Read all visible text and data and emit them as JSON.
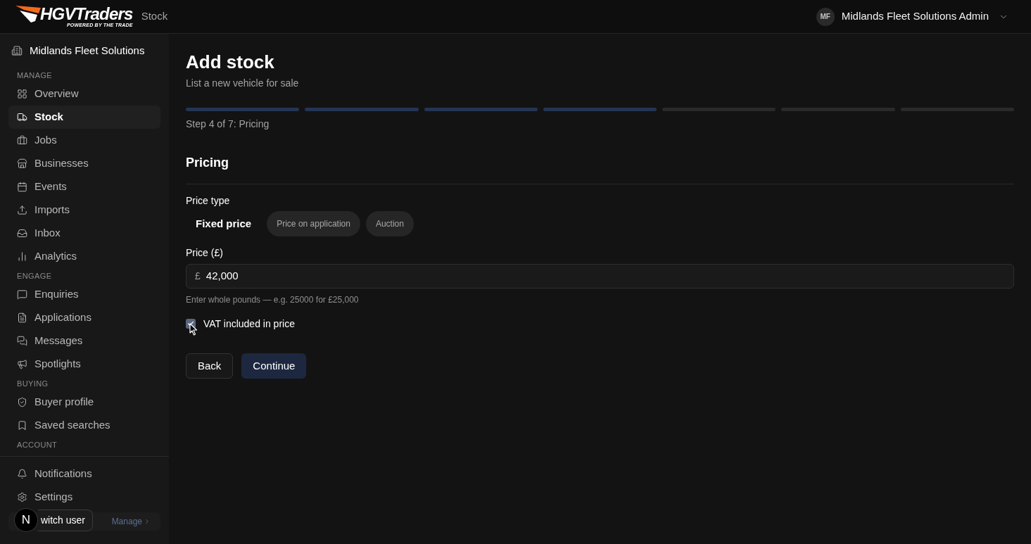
{
  "header": {
    "logo": {
      "name": "HGVTraders",
      "tagline": "POWERED BY THE TRADE"
    },
    "breadcrumb": "Stock",
    "user": {
      "initials": "MF",
      "name": "Midlands Fleet Solutions Admin"
    }
  },
  "sidebar": {
    "organization": "Midlands Fleet Solutions",
    "sections": [
      {
        "title": "MANAGE",
        "items": [
          {
            "label": "Overview",
            "selected": false
          },
          {
            "label": "Stock",
            "selected": true
          },
          {
            "label": "Jobs",
            "selected": false
          },
          {
            "label": "Businesses",
            "selected": false
          },
          {
            "label": "Events",
            "selected": false
          },
          {
            "label": "Imports",
            "selected": false
          },
          {
            "label": "Inbox",
            "selected": false
          },
          {
            "label": "Analytics",
            "selected": false
          }
        ]
      },
      {
        "title": "ENGAGE",
        "items": [
          {
            "label": "Enquiries",
            "selected": false
          },
          {
            "label": "Applications",
            "selected": false
          },
          {
            "label": "Messages",
            "selected": false
          },
          {
            "label": "Spotlights",
            "selected": false
          }
        ]
      },
      {
        "title": "BUYING",
        "items": [
          {
            "label": "Buyer profile",
            "selected": false
          },
          {
            "label": "Saved searches",
            "selected": false
          }
        ]
      },
      {
        "title": "ACCOUNT"
      }
    ],
    "footer_items": [
      {
        "label": "Notifications",
        "selected": false
      },
      {
        "label": "Settings",
        "selected": false
      }
    ],
    "plan": {
      "link": "Manage"
    }
  },
  "overlay": {
    "badge": "N",
    "button": "witch user"
  },
  "page": {
    "title": "Add stock",
    "subtitle": "List a new vehicle for sale",
    "steps": [
      {
        "complete": true
      },
      {
        "complete": true
      },
      {
        "complete": true
      },
      {
        "complete": true
      },
      {
        "complete": false
      },
      {
        "complete": false
      },
      {
        "complete": false
      }
    ],
    "step_label": "Step 4 of 7: Pricing",
    "section_title": "Pricing",
    "price_type": {
      "label": "Price type",
      "options": [
        {
          "label": "Fixed price",
          "selected": true
        },
        {
          "label": "Price on application",
          "selected": false
        },
        {
          "label": "Auction",
          "selected": false
        }
      ]
    },
    "price": {
      "label": "Price (£)",
      "prefix": "£",
      "value": "42,000",
      "hint": "Enter whole pounds — e.g. 25000 for £25,000"
    },
    "vat": {
      "label": "VAT included in price",
      "checked": true
    },
    "buttons": [
      {
        "label": "Back",
        "kind": "secondary"
      },
      {
        "label": "Continue",
        "kind": "primary"
      }
    ]
  }
}
